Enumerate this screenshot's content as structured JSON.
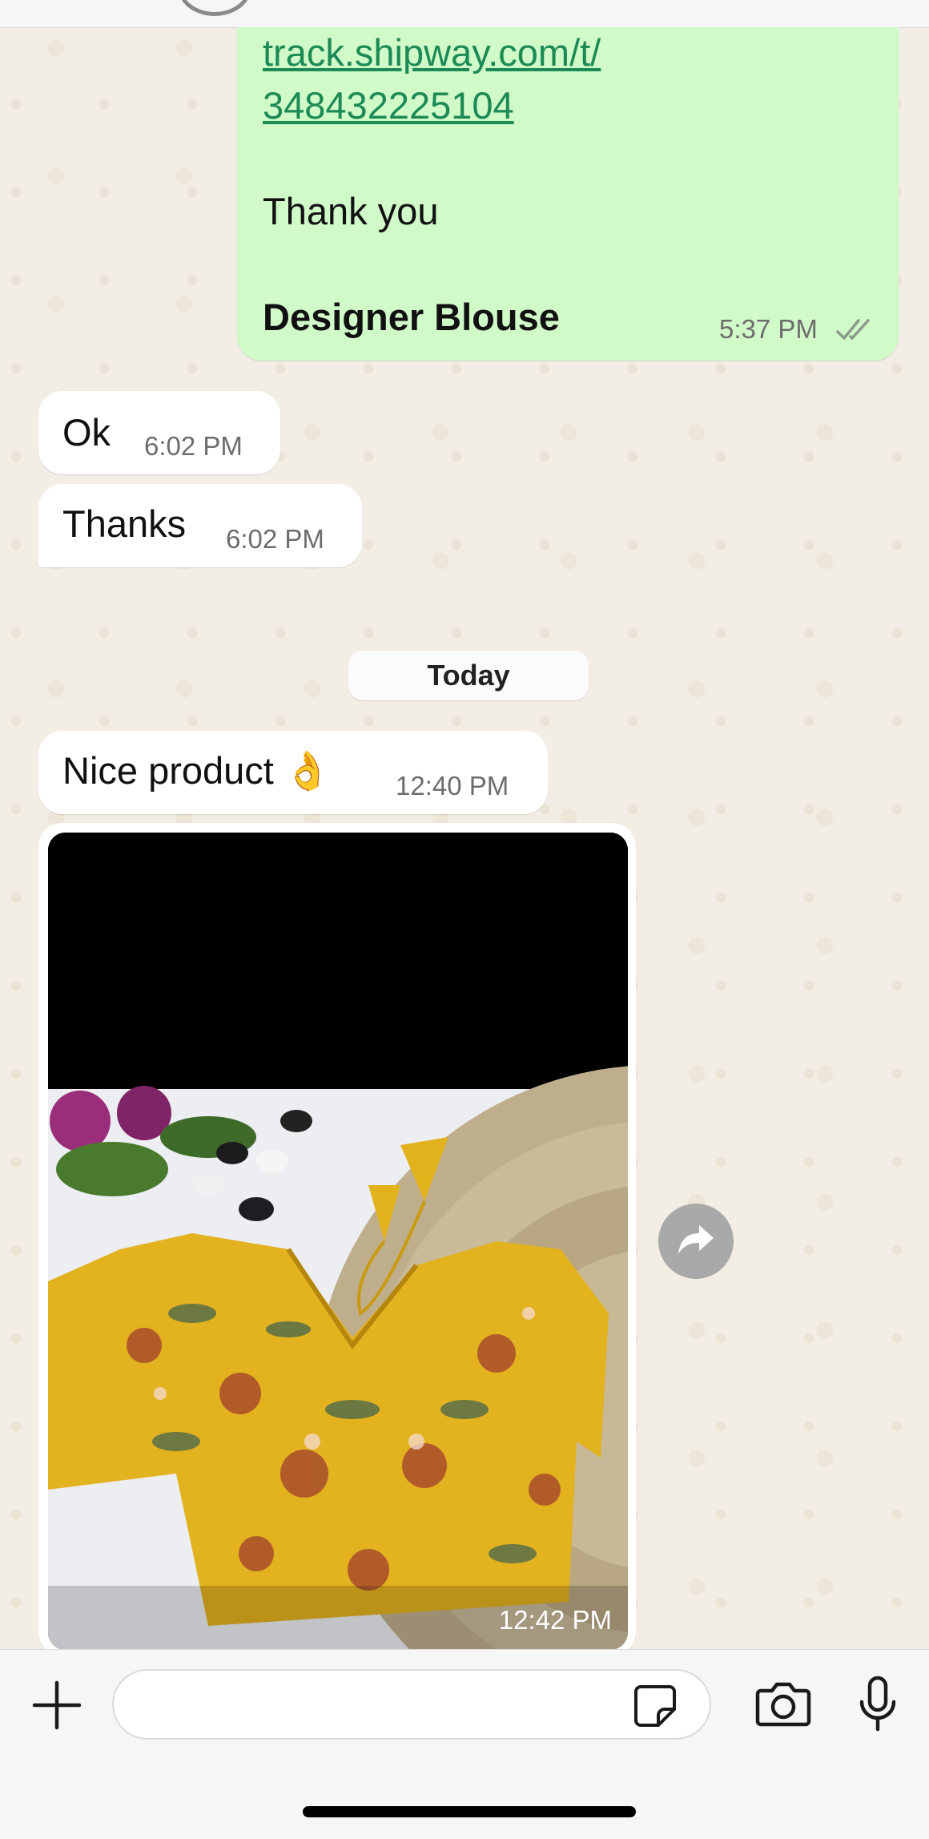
{
  "messages": {
    "outgoing_tail": {
      "link_line1": "track.shipway.com/t/",
      "link_line2": "348432225104",
      "thanks_line": "Thank you",
      "signature": "Designer Blouse",
      "time": "5:37 PM",
      "status": "double-check-icon"
    },
    "incoming": [
      {
        "text": "Ok",
        "time": "6:02 PM"
      },
      {
        "text": "Thanks",
        "time": "6:02 PM"
      },
      {
        "text": "Nice product 👌",
        "time": "12:40 PM"
      }
    ],
    "image_message": {
      "time": "12:42 PM"
    }
  },
  "date_separator": "Today",
  "composer": {
    "input_value": "",
    "icons": [
      "plus-icon",
      "sticker-icon",
      "camera-icon",
      "microphone-icon"
    ]
  },
  "colors": {
    "outgoing_bubble": "#d1fac9",
    "incoming_bubble": "#ffffff",
    "chat_background": "#f3eee5",
    "link": "#1b8a55"
  }
}
